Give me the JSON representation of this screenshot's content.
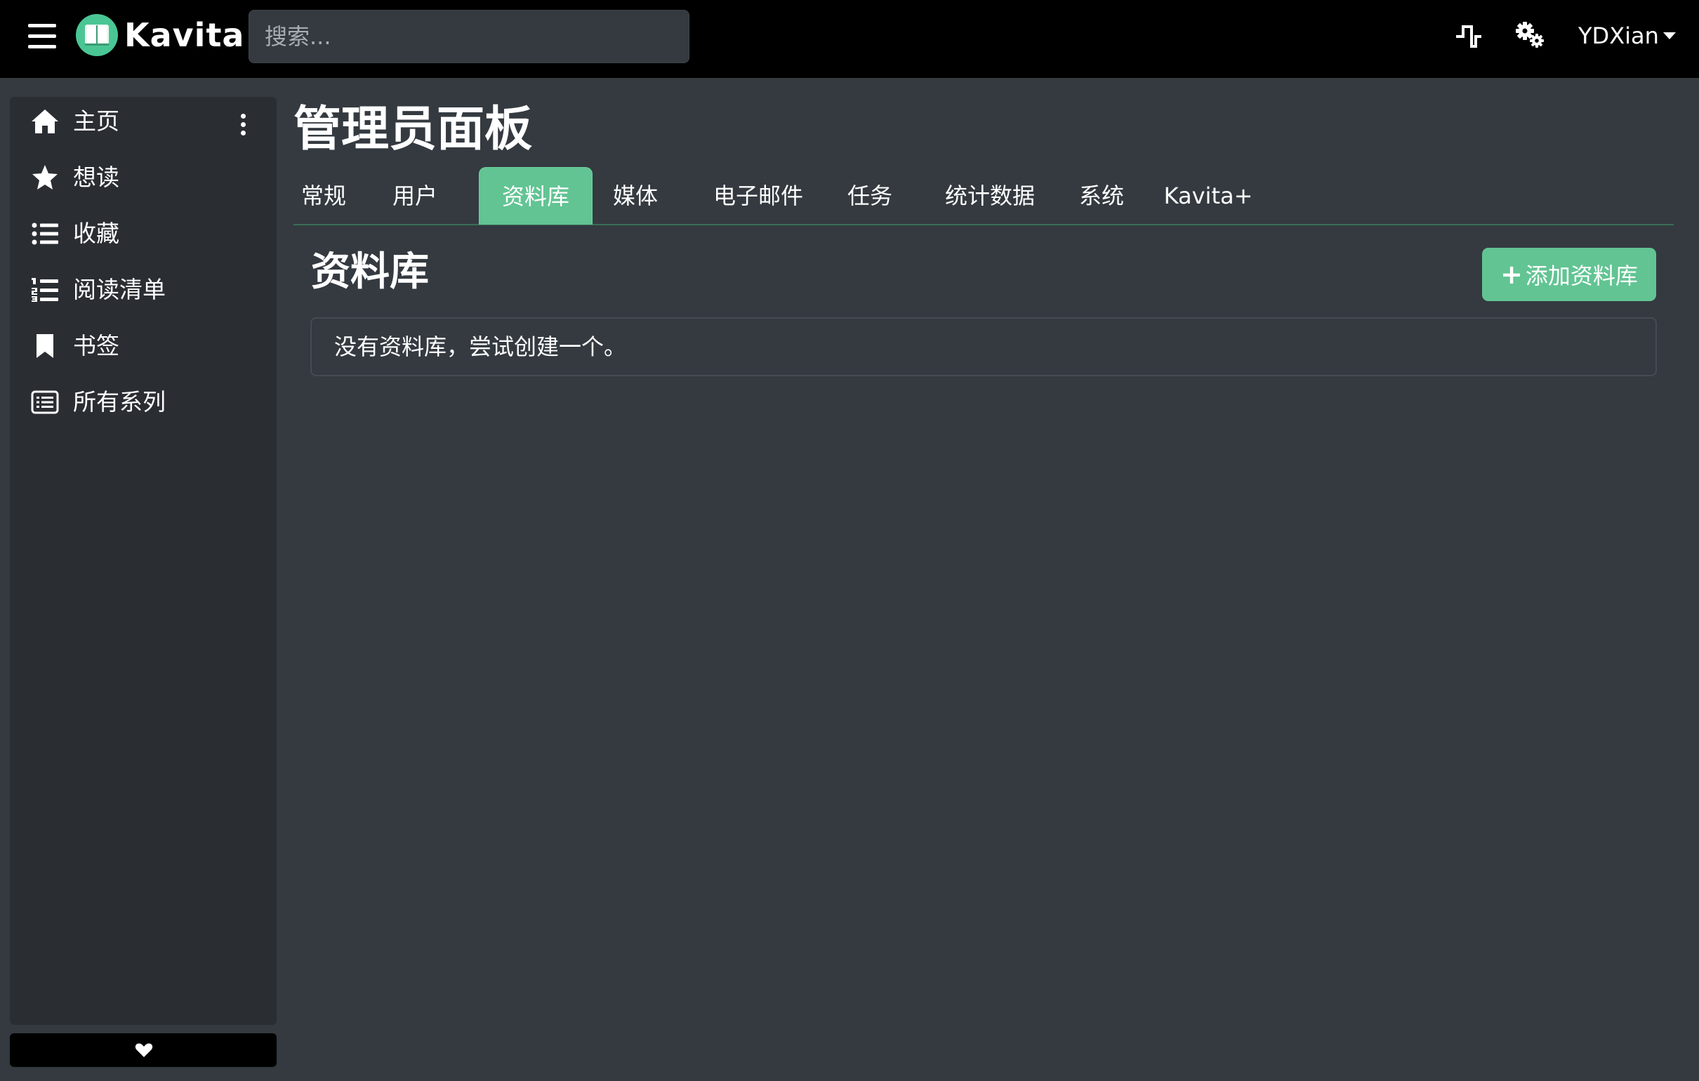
{
  "header": {
    "brand": "Kavita",
    "search_placeholder": "搜索...",
    "user_name": "YDXian"
  },
  "sidebar": {
    "items": [
      {
        "label": "主页",
        "icon": "home-icon"
      },
      {
        "label": "想读",
        "icon": "star-icon"
      },
      {
        "label": "收藏",
        "icon": "list-icon"
      },
      {
        "label": "阅读清单",
        "icon": "list-ol-icon"
      },
      {
        "label": "书签",
        "icon": "bookmark-icon"
      },
      {
        "label": "所有系列",
        "icon": "list-alt-icon"
      }
    ]
  },
  "main": {
    "title": "管理员面板",
    "tabs": [
      {
        "label": "常规",
        "active": false
      },
      {
        "label": "用户",
        "active": false
      },
      {
        "label": "资料库",
        "active": true
      },
      {
        "label": "媒体",
        "active": false
      },
      {
        "label": "电子邮件",
        "active": false
      },
      {
        "label": "任务",
        "active": false
      },
      {
        "label": "统计数据",
        "active": false
      },
      {
        "label": "系统",
        "active": false
      },
      {
        "label": "Kavita+",
        "active": false
      }
    ],
    "section_title": "资料库",
    "add_button_label": "添加资料库",
    "empty_message": "没有资料库，尝试创建一个。"
  },
  "colors": {
    "navbar_bg": "#000000",
    "page_bg": "#343a40",
    "sidebar_bg": "#2a2e33",
    "accent": "#62c493",
    "logo_bg": "#4ac694"
  }
}
